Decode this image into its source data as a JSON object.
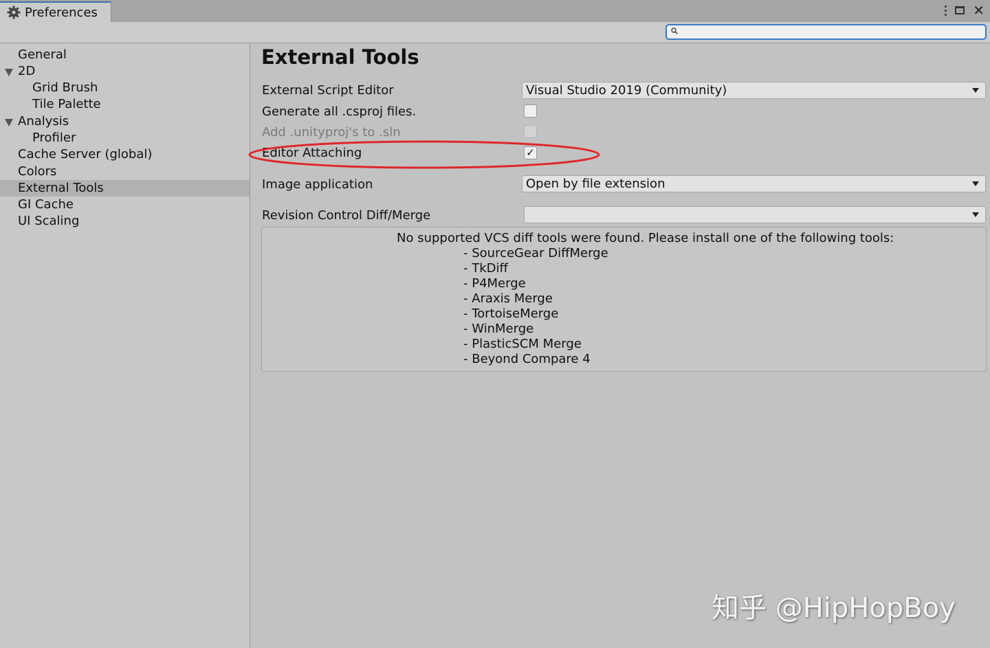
{
  "window": {
    "tab_title": "Preferences"
  },
  "search": {
    "placeholder": ""
  },
  "sidebar": {
    "items": [
      {
        "label": "General",
        "indent": 0,
        "selected": false
      },
      {
        "label": "2D",
        "indent": 0,
        "expanded": true
      },
      {
        "label": "Grid Brush",
        "indent": 1
      },
      {
        "label": "Tile Palette",
        "indent": 1
      },
      {
        "label": "Analysis",
        "indent": 0,
        "expanded": true
      },
      {
        "label": "Profiler",
        "indent": 1
      },
      {
        "label": "Cache Server (global)",
        "indent": 0
      },
      {
        "label": "Colors",
        "indent": 0
      },
      {
        "label": "External Tools",
        "indent": 0,
        "selected": true
      },
      {
        "label": "GI Cache",
        "indent": 0
      },
      {
        "label": "UI Scaling",
        "indent": 0
      }
    ]
  },
  "main": {
    "title": "External Tools",
    "external_script_editor": {
      "label": "External Script Editor",
      "value": "Visual Studio 2019 (Community)"
    },
    "generate_csproj": {
      "label": "Generate all .csproj files.",
      "checked": false
    },
    "add_unityproj": {
      "label": "Add .unityproj's to .sln",
      "checked": false,
      "disabled": true
    },
    "editor_attaching": {
      "label": "Editor Attaching",
      "checked": true,
      "check_glyph": "✓"
    },
    "image_application": {
      "label": "Image application",
      "value": "Open by file extension"
    },
    "revision_control": {
      "label": "Revision Control Diff/Merge",
      "value": ""
    },
    "vcs_info": {
      "heading": "No supported VCS diff tools were found. Please install one of the following tools:",
      "tools": [
        "- SourceGear DiffMerge",
        "- TkDiff",
        "- P4Merge",
        "- Araxis Merge",
        "- TortoiseMerge",
        "- WinMerge",
        "- PlasticSCM Merge",
        "- Beyond Compare 4"
      ]
    }
  },
  "annotation": {
    "highlight_color": "#e0262a"
  },
  "watermark": {
    "text": "知乎 @HipHopBoy"
  },
  "icons": {
    "tab": "gear-icon",
    "search": "magnifier-icon",
    "menu": "kebab-icon",
    "maximize": "maximize-icon",
    "close": "close-icon"
  }
}
